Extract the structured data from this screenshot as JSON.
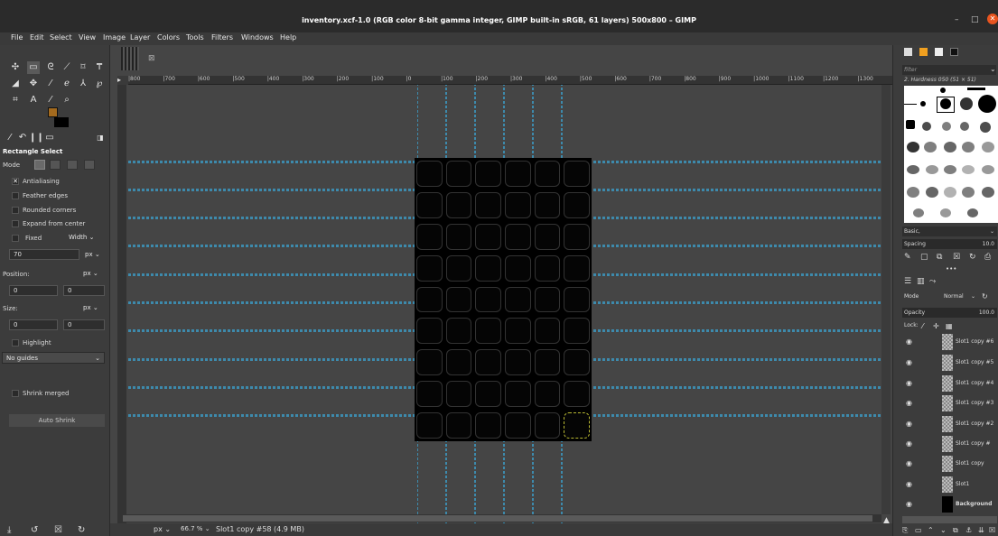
{
  "window": {
    "title": "inventory.xcf-1.0 (RGB color 8-bit gamma integer, GIMP built-in sRGB, 61 layers) 500x800 – GIMP",
    "minimize": "–",
    "maximize": "□",
    "close": "✕"
  },
  "menu": [
    "File",
    "Edit",
    "Select",
    "View",
    "Image",
    "Layer",
    "Colors",
    "Tools",
    "Filters",
    "Windows",
    "Help"
  ],
  "tool_options": {
    "title": "Rectangle Select",
    "mode_label": "Mode",
    "antialiasing": "Antialiasing",
    "feather_edges": "Feather edges",
    "rounded_corners": "Rounded corners",
    "expand_from_center": "Expand from center",
    "fixed": "Fixed",
    "fixed_type": "Width",
    "fixed_value": "70",
    "fixed_unit": "px",
    "position_label": "Position:",
    "position_unit": "px",
    "position_x": "0",
    "position_y": "0",
    "size_label": "Size:",
    "size_unit": "px",
    "size_w": "0",
    "size_h": "0",
    "highlight": "Highlight",
    "guides": "No guides",
    "auto_shrink": "Auto Shrink",
    "shrink_merged": "Shrink merged",
    "colors": {
      "foreground": "#a36a1e",
      "background": "#ffffff"
    }
  },
  "toolbox_bottom": [
    "⤓",
    "↺",
    "☒",
    "↻"
  ],
  "canvas": {
    "thumb_close": "⊠",
    "ruler_h": [
      "|800",
      "|700",
      "|600",
      "|500",
      "|400",
      "|300",
      "|200",
      "|100",
      "|0",
      "|100",
      "|200",
      "|300",
      "|400",
      "|500",
      "|600",
      "|700",
      "|800",
      "|900",
      "|1000",
      "|1100",
      "|1200",
      "|1300"
    ],
    "rows": 9,
    "cols": 6,
    "selected_slot": "last",
    "guide_color": "#3aa8d8"
  },
  "status": {
    "unit": "px",
    "zoom": "66.7 %",
    "info": "Slot1 copy #58 (4.9 MB)"
  },
  "dock": {
    "filter_placeholder": "filter",
    "brush_name": "2. Hardness 050 (51 × 51)",
    "preset": "Basic,",
    "spacing_label": "Spacing",
    "spacing_value": "10.0",
    "mode_label": "Mode",
    "mode_value": "Normal",
    "opacity_label": "Opacity",
    "opacity_value": "100.0",
    "lock_label": "Lock:",
    "layers": [
      "Slot1 copy #6",
      "Slot1 copy #5",
      "Slot1 copy #4",
      "Slot1 copy #3",
      "Slot1 copy #2",
      "Slot1 copy #",
      "Slot1 copy",
      "Slot1",
      "Background"
    ]
  }
}
